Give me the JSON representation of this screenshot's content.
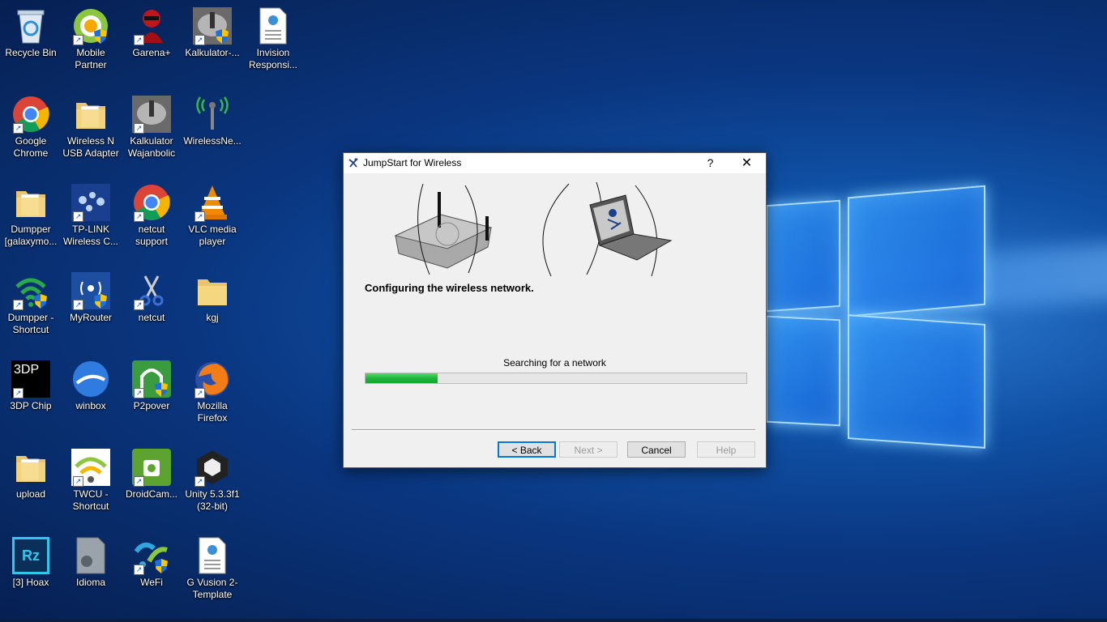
{
  "desktop": {
    "icons": [
      {
        "label": "Recycle Bin",
        "icon": "recycle-bin-icon"
      },
      {
        "label": "Mobile Partner",
        "icon": "mobile-partner-icon"
      },
      {
        "label": "Garena+",
        "icon": "garena-icon"
      },
      {
        "label": "Kalkulator-...",
        "icon": "kalkulator-icon"
      },
      {
        "label": "Invision Responsi...",
        "icon": "html-file-icon"
      },
      {
        "label": "Google Chrome",
        "icon": "chrome-icon"
      },
      {
        "label": "Wireless N USB Adapter",
        "icon": "folder-icon"
      },
      {
        "label": "Kalkulator Wajanbolic",
        "icon": "kalkulator-icon"
      },
      {
        "label": "WirelessNe...",
        "icon": "wireless-antenna-icon"
      },
      {
        "label": "Dumpper [galaxymo...",
        "icon": "folder-icon"
      },
      {
        "label": "TP-LINK Wireless C...",
        "icon": "tplink-icon"
      },
      {
        "label": "netcut support",
        "icon": "chrome-icon"
      },
      {
        "label": "VLC media player",
        "icon": "vlc-icon"
      },
      {
        "label": "Dumpper - Shortcut",
        "icon": "wifi-icon"
      },
      {
        "label": "MyRouter",
        "icon": "myrouter-icon"
      },
      {
        "label": "netcut",
        "icon": "scissors-icon"
      },
      {
        "label": "kgj",
        "icon": "folder-icon"
      },
      {
        "label": "3DP Chip",
        "icon": "3dp-chip-icon"
      },
      {
        "label": "winbox",
        "icon": "winbox-icon"
      },
      {
        "label": "P2pover",
        "icon": "p2pover-icon"
      },
      {
        "label": "Mozilla Firefox",
        "icon": "firefox-icon"
      },
      {
        "label": "upload",
        "icon": "folder-icon"
      },
      {
        "label": "TWCU - Shortcut",
        "icon": "wifi-icon"
      },
      {
        "label": "DroidCam...",
        "icon": "droidcam-icon"
      },
      {
        "label": "Unity 5.3.3f1 (32-bit)",
        "icon": "unity-icon"
      },
      {
        "label": "[3] Hoax",
        "icon": "rz-icon"
      },
      {
        "label": "Idioma",
        "icon": "gear-file-icon"
      },
      {
        "label": "WeFi",
        "icon": "wefi-icon"
      },
      {
        "label": "G Vusion 2-Template",
        "icon": "html-file-icon"
      }
    ],
    "icon_3dp_text": "3DP",
    "icon_rz_text": "Rz"
  },
  "dialog": {
    "title": "JumpStart for Wireless",
    "help_glyph": "?",
    "close_glyph": "✕",
    "heading": "Configuring the wireless network.",
    "status": "Searching for a network",
    "progress_fraction": 0.19,
    "buttons": {
      "back": "< Back",
      "next": "Next >",
      "cancel": "Cancel",
      "help": "Help"
    }
  },
  "colors": {
    "progress_green": "#1fb43c",
    "default_button_border": "#0078d7"
  }
}
